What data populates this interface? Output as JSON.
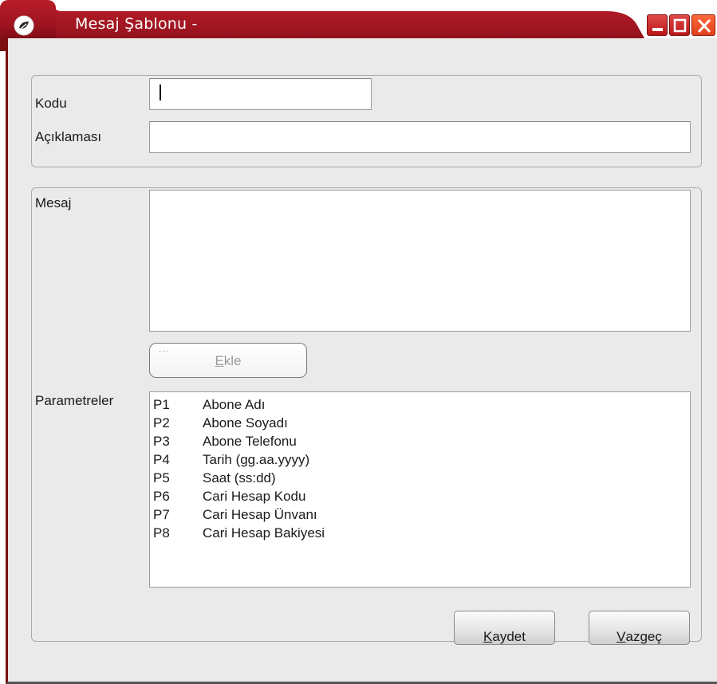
{
  "window": {
    "title": "Mesaj Şablonu -",
    "colors": {
      "titlebar": "#a11620",
      "titlebar_dark": "#6d0a10",
      "body": "#eaeaea"
    }
  },
  "form": {
    "kodu_label": "Kodu",
    "kodu_value": "",
    "aciklama_label": "Açıklaması",
    "aciklama_value": "",
    "mesaj_label": "Mesaj",
    "mesaj_value": "",
    "ekle_dots": "···",
    "ekle_label_first": "E",
    "ekle_label_rest": "kle",
    "parametreler_label": "Parametreler"
  },
  "parameters": [
    {
      "code": "P1",
      "name": "Abone Adı"
    },
    {
      "code": "P2",
      "name": "Abone Soyadı"
    },
    {
      "code": "P3",
      "name": "Abone Telefonu"
    },
    {
      "code": "P4",
      "name": "Tarih (gg.aa.yyyy)"
    },
    {
      "code": "P5",
      "name": "Saat (ss:dd)"
    },
    {
      "code": "P6",
      "name": "Cari Hesap Kodu"
    },
    {
      "code": "P7",
      "name": "Cari Hesap Ünvanı"
    },
    {
      "code": "P8",
      "name": "Cari Hesap Bakiyesi"
    }
  ],
  "buttons": {
    "kaydet_first": "K",
    "kaydet_rest": "aydet",
    "vazgec_first": "V",
    "vazgec_rest": "azgeç"
  },
  "icons": {
    "app": "leaf-icon",
    "minimize": "minimize-icon",
    "maximize": "maximize-icon",
    "close": "close-icon"
  }
}
